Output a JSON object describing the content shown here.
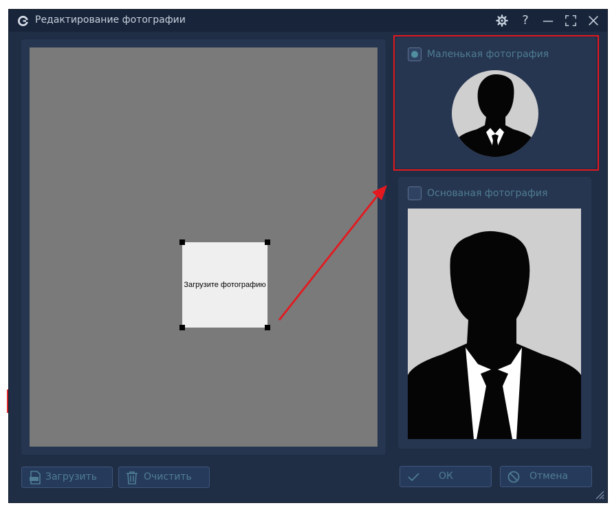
{
  "window": {
    "title": "Редактирование фотографии",
    "controls": [
      "gear-icon",
      "help-icon",
      "minimize-icon",
      "fullscreen-icon",
      "close-icon"
    ],
    "help_glyph": "?"
  },
  "editor": {
    "upload_prompt": "Загрузите фотографию"
  },
  "options": {
    "small_photo": {
      "label": "Маленькая фотография",
      "selected": true
    },
    "main_photo": {
      "label": "Основаная фотография",
      "selected": false
    }
  },
  "buttons": {
    "upload": "Загрузить",
    "clear": "Очистить",
    "ok": "ОК",
    "cancel": "Отмена"
  },
  "colors": {
    "background": "#1f2d45",
    "panel": "#263550",
    "accent_text": "#4f7d93",
    "highlight": "#e3191f"
  }
}
